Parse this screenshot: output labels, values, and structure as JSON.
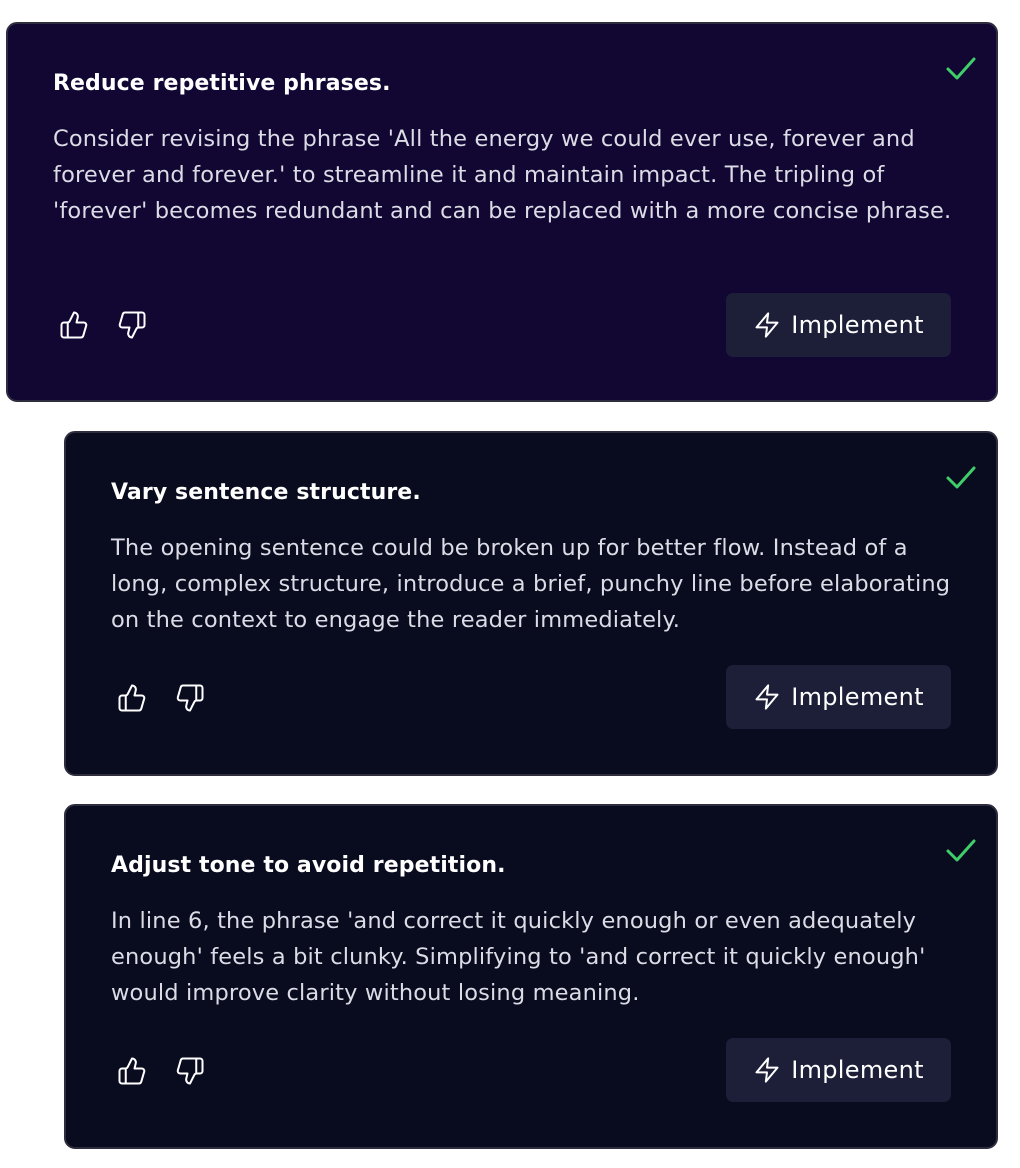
{
  "colors": {
    "card_active_bg": "#120633",
    "card_bg": "#090b1f",
    "card_border": "#2e2d3d",
    "button_bg": "#1d1e38",
    "check_green": "#3fcf6a",
    "title_text": "#ffffff",
    "body_text": "#dcdce6"
  },
  "suggestions": [
    {
      "title": "Reduce repetitive phrases.",
      "body": "Consider revising the phrase 'All the energy we could ever use, forever and forever and forever.' to streamline it and maintain impact. The tripling of 'forever' becomes redundant and can be replaced with a more concise phrase.",
      "icons": {
        "status": "check-icon",
        "like": "thumbs-up-icon",
        "dislike": "thumbs-down-icon",
        "action": "lightning-bolt-icon"
      },
      "action_label": "Implement"
    },
    {
      "title": "Vary sentence structure.",
      "body": "The opening sentence could be broken up for better flow. Instead of a long, complex structure, introduce a brief, punchy line before elaborating on the context to engage the reader immediately.",
      "icons": {
        "status": "check-icon",
        "like": "thumbs-up-icon",
        "dislike": "thumbs-down-icon",
        "action": "lightning-bolt-icon"
      },
      "action_label": "Implement"
    },
    {
      "title": "Adjust tone to avoid repetition.",
      "body": "In line 6, the phrase 'and correct it quickly enough or even adequately enough' feels a bit clunky. Simplifying to 'and correct it quickly enough' would improve clarity without losing meaning.",
      "icons": {
        "status": "check-icon",
        "like": "thumbs-up-icon",
        "dislike": "thumbs-down-icon",
        "action": "lightning-bolt-icon"
      },
      "action_label": "Implement"
    }
  ]
}
